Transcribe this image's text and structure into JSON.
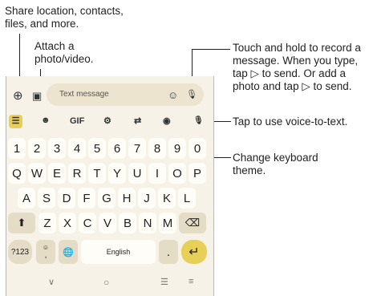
{
  "callouts": {
    "share": "Share location, contacts,\nfiles, and more.",
    "attach": "Attach a\nphoto/video.",
    "record": "Touch and hold to record a\nmessage. When you type,\ntap ▷ to send. Or add a\nphoto and tap ▷ to send.",
    "voice": "Tap to use voice-to-text.",
    "theme": "Change keyboard\ntheme."
  },
  "compose": {
    "placeholder": "Text message",
    "add_icon": "⊕",
    "gallery_icon": "▣",
    "emoji_icon": "☺",
    "mic_icon": "🎙"
  },
  "toolbar": {
    "apps": "☰",
    "sticker": "☻",
    "gif": "GIF",
    "settings": "⚙",
    "translate": "⇄",
    "palette": "◉",
    "mic": "🎙"
  },
  "keys": {
    "row1": [
      "1",
      "2",
      "3",
      "4",
      "5",
      "6",
      "7",
      "8",
      "9",
      "0"
    ],
    "row2": [
      "Q",
      "W",
      "E",
      "R",
      "T",
      "Y",
      "U",
      "I",
      "O",
      "P"
    ],
    "row3": [
      "A",
      "S",
      "D",
      "F",
      "G",
      "H",
      "J",
      "K",
      "L"
    ],
    "row4": [
      "Z",
      "X",
      "C",
      "V",
      "B",
      "N",
      "M"
    ],
    "shift": "⬆",
    "backspace": "⌫",
    "sym": "?123",
    "comma": ",",
    "emoji_comma": "☺",
    "globe": "🌐",
    "space": "English",
    "period": ".",
    "enter": "↵"
  },
  "navbar": {
    "down": "∨",
    "home": "○",
    "switch": "☰",
    "menu": "≡"
  },
  "colors": {
    "keyboard_bg": "#f6f2e8",
    "key_bg": "#fffdf7",
    "accent": "#e7cf58"
  }
}
